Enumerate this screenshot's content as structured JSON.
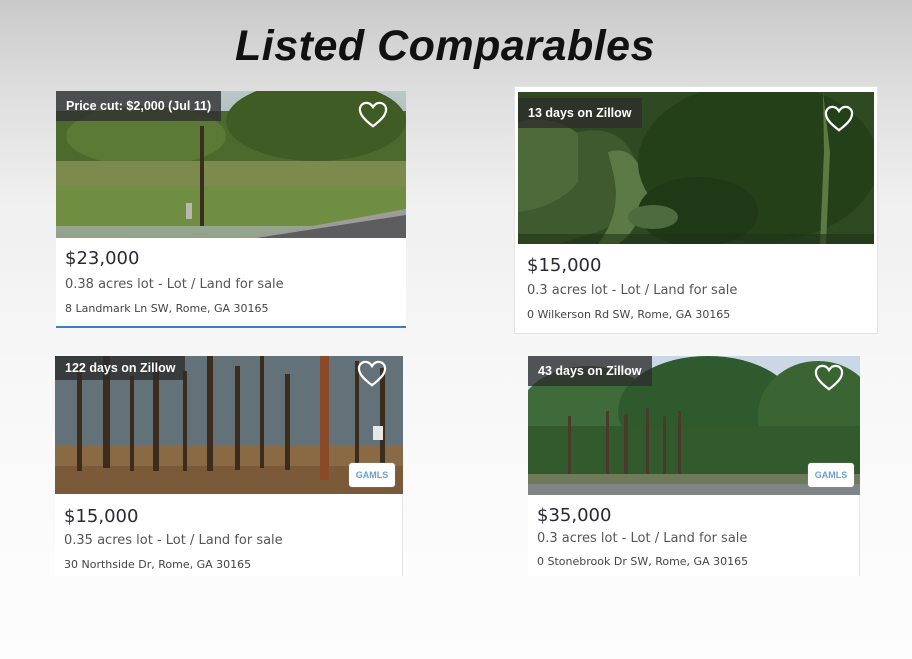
{
  "title": "Listed Comparables",
  "listings": [
    {
      "badge": "Price cut: $2,000 (Jul 11)",
      "price": "$23,000",
      "details": "0.38 acres lot - Lot / Land for sale",
      "address": "8 Landmark Ln SW, Rome, GA 30165",
      "mls_logo": ""
    },
    {
      "badge": "13 days on Zillow",
      "price": "$15,000",
      "details": "0.3 acres lot - Lot / Land for sale",
      "address": "0 Wilkerson Rd SW, Rome, GA 30165",
      "mls_logo": ""
    },
    {
      "badge": "122 days on Zillow",
      "price": "$15,000",
      "details": "0.35 acres lot - Lot / Land for sale",
      "address": "30 Northside Dr, Rome, GA 30165",
      "mls_logo": "GAMLS"
    },
    {
      "badge": "43 days on Zillow",
      "price": "$35,000",
      "details": "0.3 acres lot - Lot / Land for sale",
      "address": "0 Stonebrook Dr SW, Rome, GA 30165",
      "mls_logo": "GAMLS"
    }
  ],
  "icons": {
    "favorite": "heart-outline-icon",
    "mls": "gamls-logo"
  },
  "colors": {
    "accent": "#3b7cc7",
    "badge_bg": "#2d2d2d"
  }
}
